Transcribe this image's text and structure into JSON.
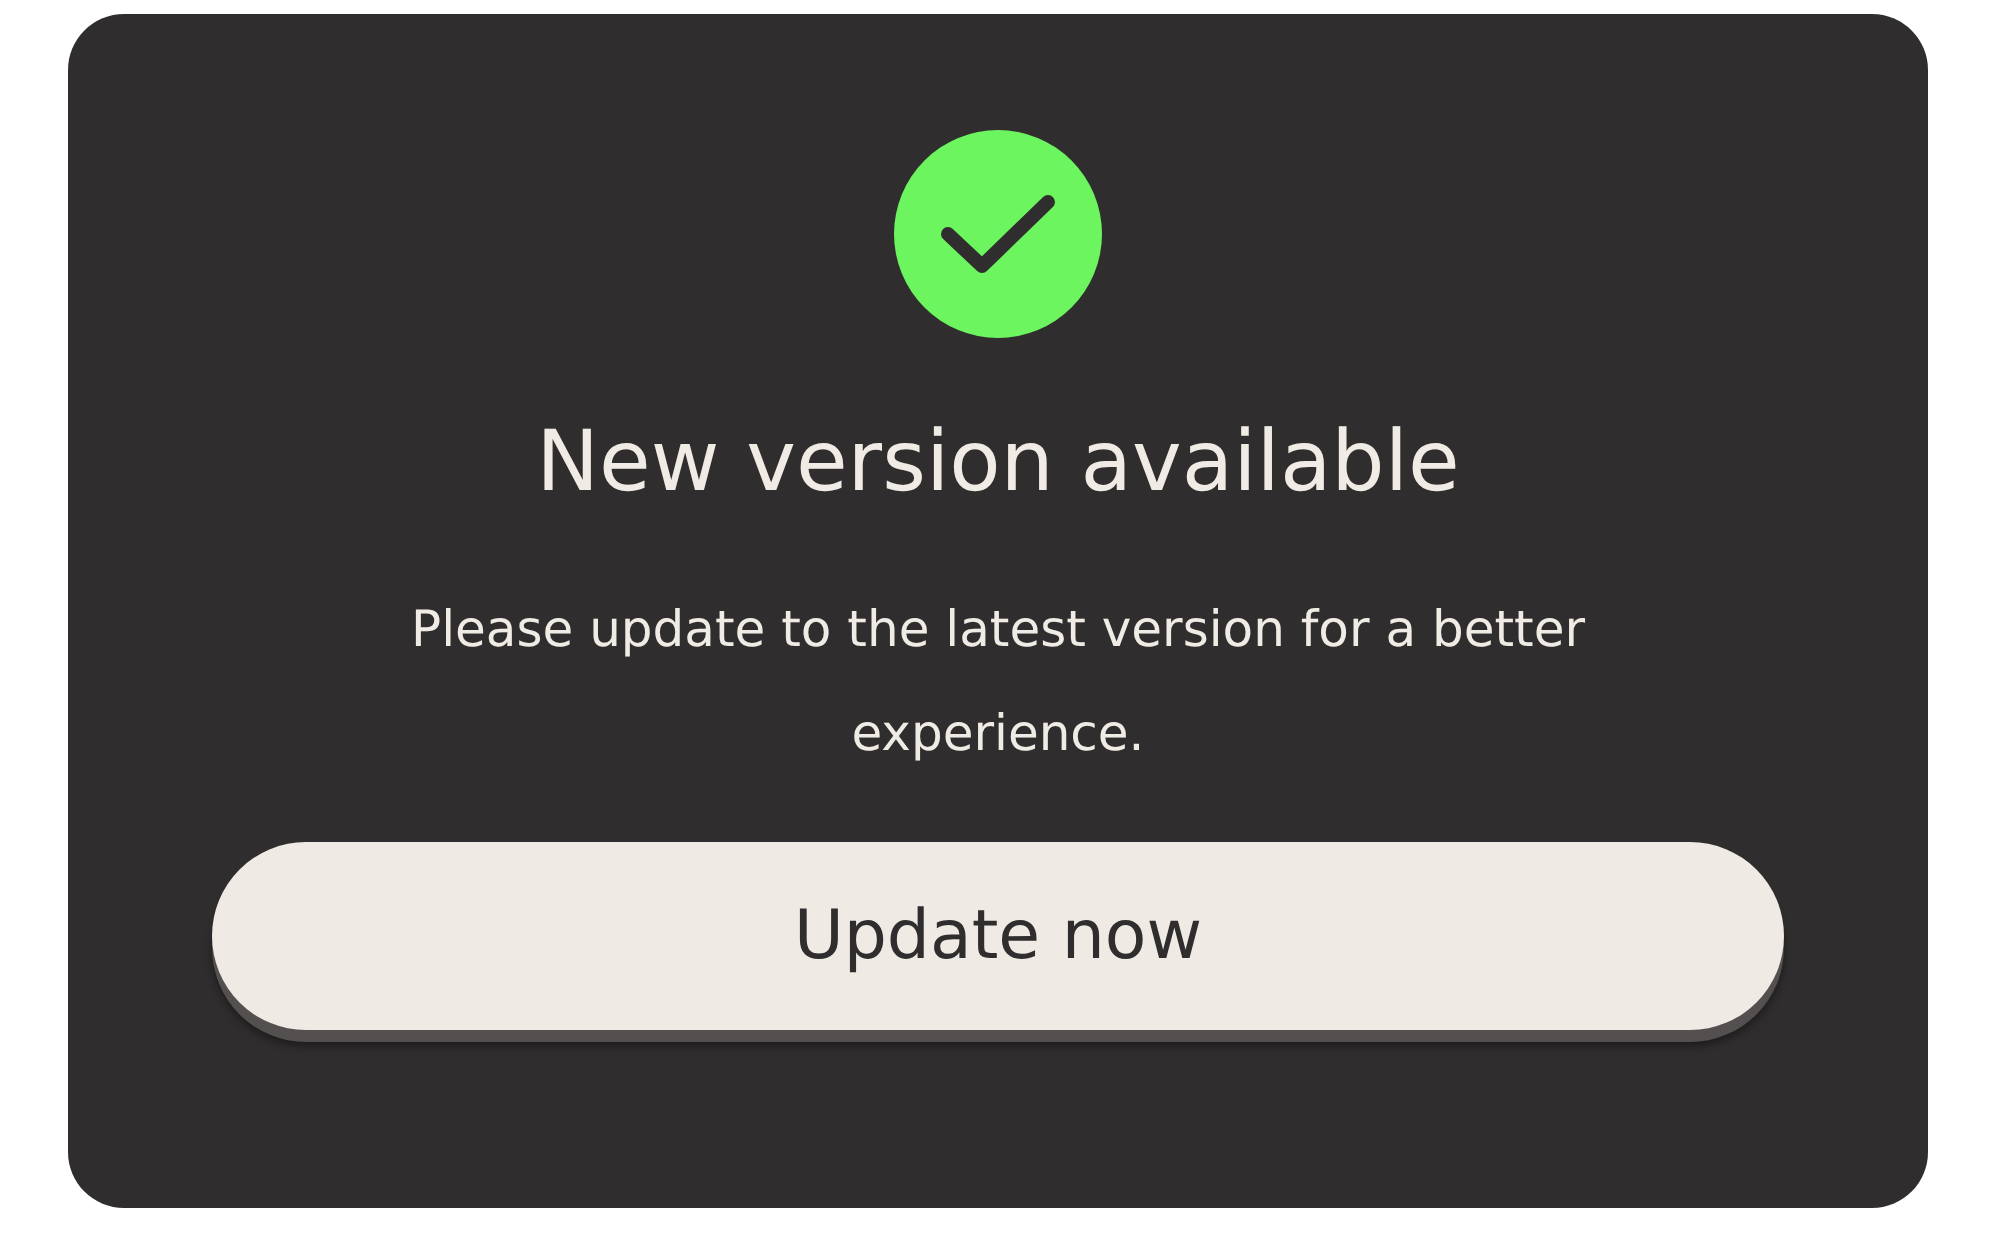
{
  "dialog": {
    "title": "New version available",
    "message": "Please update to the latest version for a better experience.",
    "button": "Update now"
  }
}
